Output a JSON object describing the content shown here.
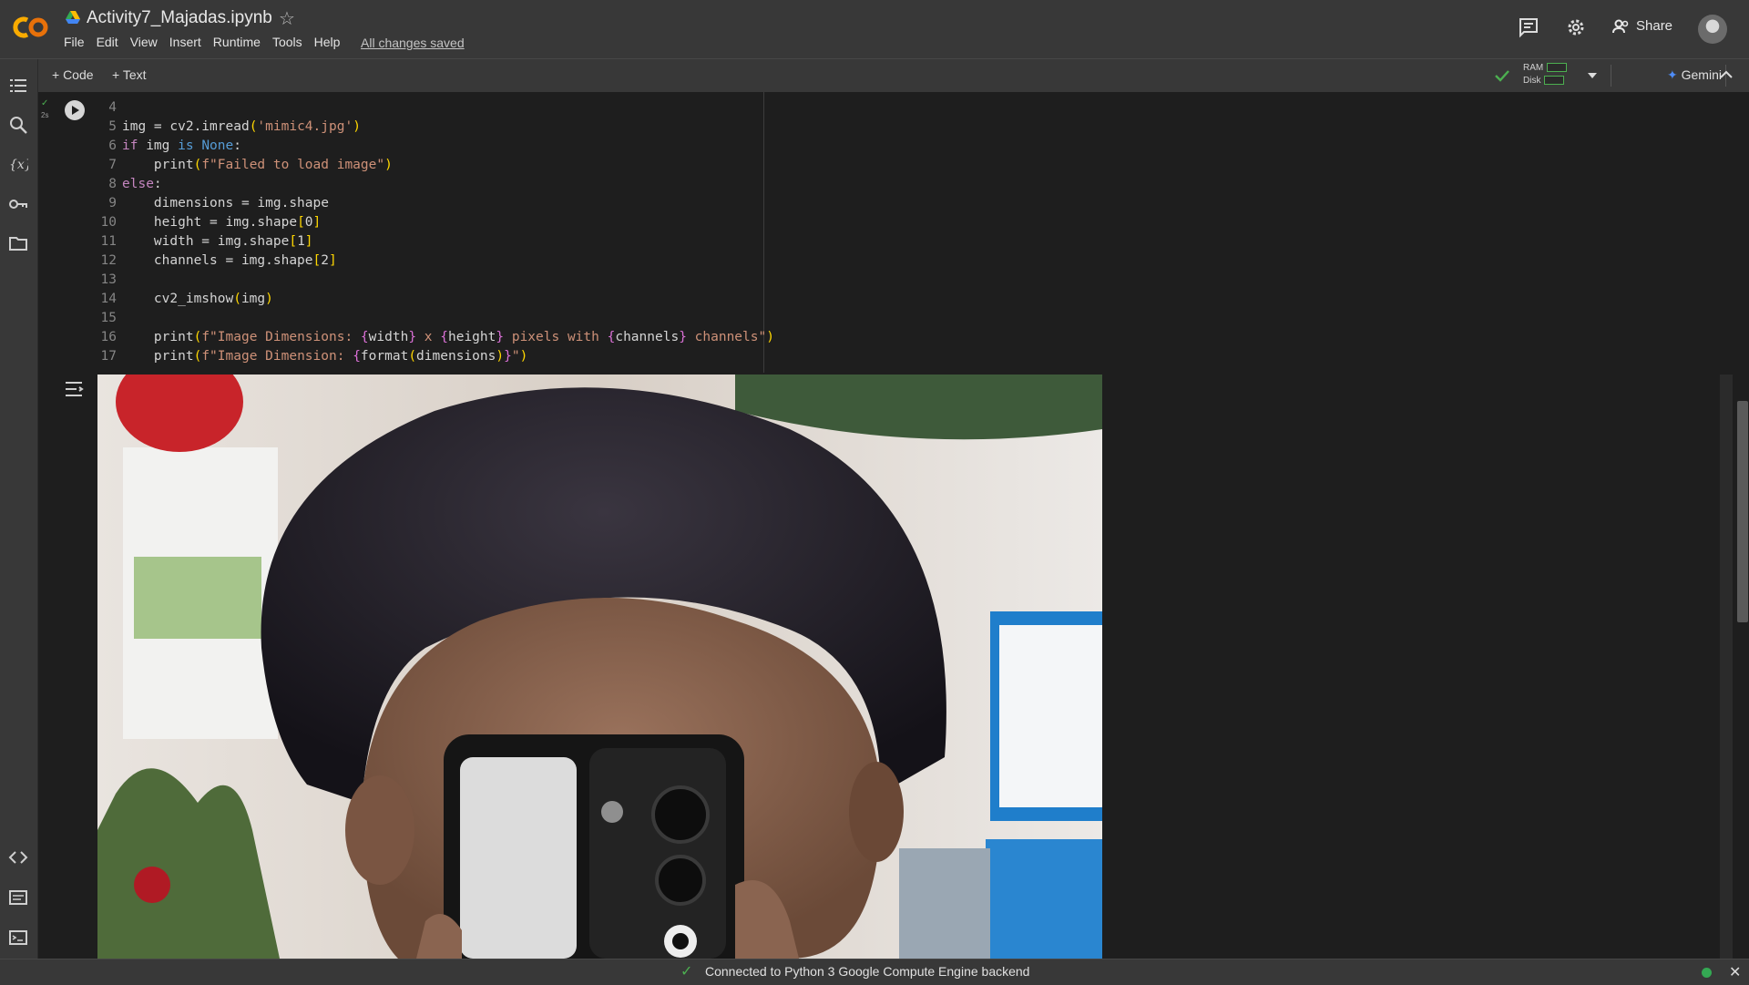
{
  "header": {
    "title": "Activity7_Majadas.ipynb",
    "menu": [
      "File",
      "Edit",
      "View",
      "Insert",
      "Runtime",
      "Tools",
      "Help"
    ],
    "saved_status": "All changes saved",
    "share_label": "Share"
  },
  "toolbar": {
    "code_label": "+ Code",
    "text_label": "+ Text",
    "ram_label": "RAM",
    "disk_label": "Disk",
    "gemini_label": "Gemini"
  },
  "cell": {
    "exec_time": "2s",
    "lines": [
      {
        "num": "4",
        "text": ""
      },
      {
        "num": "5",
        "text": "img = cv2.imread('mimic4.jpg')"
      },
      {
        "num": "6",
        "text": "if img is None:"
      },
      {
        "num": "7",
        "text": "    print(f\"Failed to load image\")"
      },
      {
        "num": "8",
        "text": "else:"
      },
      {
        "num": "9",
        "text": "    dimensions = img.shape"
      },
      {
        "num": "10",
        "text": "    height = img.shape[0]"
      },
      {
        "num": "11",
        "text": "    width = img.shape[1]"
      },
      {
        "num": "12",
        "text": "    channels = img.shape[2]"
      },
      {
        "num": "13",
        "text": ""
      },
      {
        "num": "14",
        "text": "    cv2_imshow(img)"
      },
      {
        "num": "15",
        "text": ""
      },
      {
        "num": "16",
        "text": "    print(f\"Image Dimensions: {width} x {height} pixels with {channels} channels\")"
      },
      {
        "num": "17",
        "text": "    print(f\"Image Dimension: {format(dimensions)}\")"
      }
    ]
  },
  "status": {
    "message": "Connected to Python 3 Google Compute Engine backend"
  },
  "colors": {
    "background": "#1e1e1e",
    "chrome": "#383838",
    "keyword": "#c586c0",
    "string": "#ce9178",
    "ok": "#34a853"
  }
}
